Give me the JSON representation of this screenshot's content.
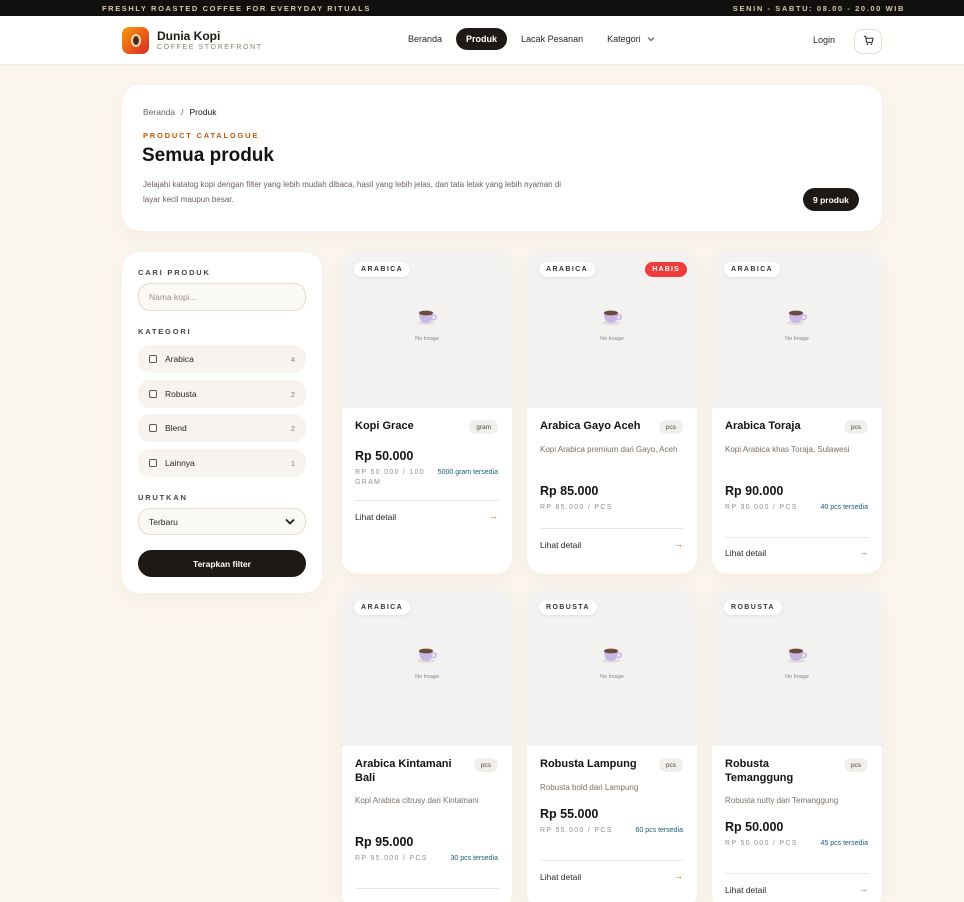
{
  "topbar": {
    "tagline": "FRESHLY ROASTED COFFEE FOR EVERYDAY RITUALS",
    "hours": "SENIN - SABTU: 08.00 - 20.00 WIB"
  },
  "navbar": {
    "brand_name": "Dunia Kopi",
    "brand_sub": "COFFEE STOREFRONT",
    "links": [
      {
        "label": "Beranda",
        "active": false
      },
      {
        "label": "Produk",
        "active": true
      },
      {
        "label": "Lacak Pesanan",
        "active": false
      },
      {
        "label": "Kategori",
        "active": false
      }
    ],
    "login_label": "Login",
    "cart_icon": "cart-icon"
  },
  "hero": {
    "breadcrumb": {
      "home": "Beranda",
      "separator": "/",
      "current": "Produk"
    },
    "eyebrow": "PRODUCT CATALOGUE",
    "title": "Semua produk",
    "description": "Jelajahi katalog kopi dengan filter yang lebih mudah dibaca, hasil yang lebih jelas, dan tata letak yang lebih nyaman di layar kecil maupun besar.",
    "count_badge": "9 produk"
  },
  "filters": {
    "search_label": "CARI PRODUK",
    "search_placeholder": "Nama kopi...",
    "category_label": "KATEGORI",
    "categories": [
      {
        "name": "Arabica",
        "count": "4"
      },
      {
        "name": "Robusta",
        "count": "2"
      },
      {
        "name": "Blend",
        "count": "2"
      },
      {
        "name": "Lainnya",
        "count": "1"
      }
    ],
    "sort_label": "URUTKAN",
    "sort_selected": "Terbaru",
    "apply_label": "Terapkan filter"
  },
  "common": {
    "no_image": "No Image",
    "detail_label": "Lihat detail",
    "arrow": "→"
  },
  "products": [
    {
      "tag": "ARABICA",
      "name": "Kopi Grace",
      "unit": "gram",
      "desc": "",
      "price": "Rp 50.000",
      "per_unit": "RP 50.000 / 100 GRAM",
      "stock": "5000 gram tersedia",
      "sold_out": ""
    },
    {
      "tag": "ARABICA",
      "name": "Arabica Gayo Aceh",
      "unit": "pcs",
      "desc": "Kopi Arabica premium dari Gayo, Aceh",
      "price": "Rp 85.000",
      "per_unit": "RP 85.000 / PCS",
      "stock": "",
      "sold_out": "HABIS"
    },
    {
      "tag": "ARABICA",
      "name": "Arabica Toraja",
      "unit": "pcs",
      "desc": "Kopi Arabica khas Toraja, Sulawesi",
      "price": "Rp 90.000",
      "per_unit": "RP 90.000 / PCS",
      "stock": "40 pcs tersedia",
      "sold_out": ""
    },
    {
      "tag": "ARABICA",
      "name": "Arabica Kintamani Bali",
      "unit": "pcs",
      "desc": "Kopi Arabica citrusy dari Kintamani",
      "price": "Rp 95.000",
      "per_unit": "RP 95.000 / PCS",
      "stock": "30 pcs tersedia",
      "sold_out": ""
    },
    {
      "tag": "ROBUSTA",
      "name": "Robusta Lampung",
      "unit": "pcs",
      "desc": "Robusta bold dari Lampung",
      "price": "Rp 55.000",
      "per_unit": "RP 55.000 / PCS",
      "stock": "60 pcs tersedia",
      "sold_out": ""
    },
    {
      "tag": "ROBUSTA",
      "name": "Robusta Temanggung",
      "unit": "pcs",
      "desc": "Robusta nutty dari Temanggung",
      "price": "Rp 50.000",
      "per_unit": "RP 50.000 / PCS",
      "stock": "45 pcs tersedia",
      "sold_out": ""
    }
  ]
}
